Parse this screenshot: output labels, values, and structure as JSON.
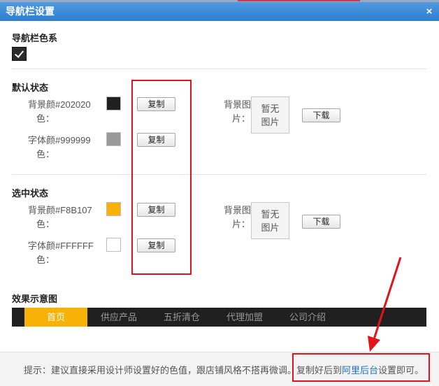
{
  "dialog": {
    "title": "导航栏设置",
    "close_glyph": "×"
  },
  "nav_color": {
    "section_title": "导航栏色系",
    "checked": true
  },
  "default_state": {
    "section_title": "默认状态",
    "bg": {
      "label_line1": "背景颜#202020",
      "label_line2": "色：",
      "color": "#202020",
      "copy_label": "复制"
    },
    "font": {
      "label_line1": "字体颜#999999",
      "label_line2": "色：",
      "color": "#999999",
      "copy_label": "复制"
    },
    "bg_image": {
      "label_line1": "背景图",
      "label_line2": "片：",
      "placeholder_line1": "暂无",
      "placeholder_line2": "图片",
      "download_label": "下载"
    }
  },
  "selected_state": {
    "section_title": "选中状态",
    "bg": {
      "label_line1": "背景颜#F8B107",
      "label_line2": "色：",
      "color": "#F8B107",
      "copy_label": "复制"
    },
    "font": {
      "label_line1": "字体颜#FFFFFF",
      "label_line2": "色：",
      "color": "#FFFFFF",
      "copy_label": "复制"
    },
    "bg_image": {
      "label_line1": "背景图",
      "label_line2": "片：",
      "placeholder_line1": "暂无",
      "placeholder_line2": "图片",
      "download_label": "下载"
    }
  },
  "preview": {
    "section_title": "效果示意图",
    "items": [
      "首页",
      "供应产品",
      "五折清仓",
      "代理加盟",
      "公司介绍"
    ],
    "active_index": 0
  },
  "footer": {
    "hint_prefix": "提示：建议直接采用设计师设置好的色值，跟店铺风格不搭再微调。复制好后到",
    "hint_link": "阿里后台",
    "hint_suffix": "设置即可。"
  },
  "colors": {
    "title_bar": "#2e7fcf",
    "annotation_red": "#e2141b",
    "link": "#1e6fc7"
  }
}
